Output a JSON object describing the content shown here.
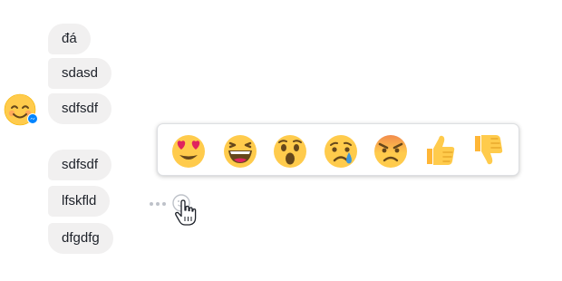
{
  "conversation": {
    "messages": [
      {
        "text": "đá"
      },
      {
        "text": "sdasd"
      },
      {
        "text": "sdfsdf"
      },
      {
        "text": "sdfsdf"
      },
      {
        "text": "lfskfld"
      },
      {
        "text": "dfgdfg"
      }
    ]
  },
  "reactions": [
    {
      "name": "love",
      "icon": "heart-eyes-icon"
    },
    {
      "name": "haha",
      "icon": "laughing-icon"
    },
    {
      "name": "wow",
      "icon": "surprised-icon"
    },
    {
      "name": "sad",
      "icon": "crying-icon"
    },
    {
      "name": "angry",
      "icon": "angry-icon"
    },
    {
      "name": "like",
      "icon": "thumbs-up-icon"
    },
    {
      "name": "dislike",
      "icon": "thumbs-down-icon"
    }
  ],
  "colors": {
    "bubble_bg": "#f1f0f0",
    "emoji_yellow": "#ffcb4c",
    "heart_red": "#e0245e",
    "messenger_blue": "#0084ff"
  }
}
